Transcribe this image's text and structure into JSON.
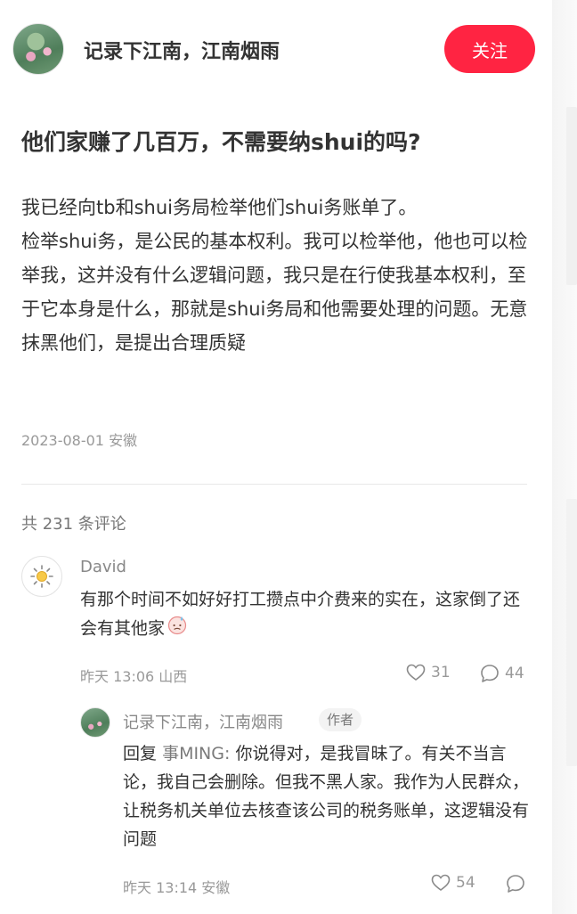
{
  "header": {
    "author_name": "记录下江南，江南烟雨",
    "follow_label": "关注"
  },
  "post": {
    "title": "他们家赚了几百万，不需要纳shui的吗?",
    "paragraph_1": "我已经向tb和shui务局检举他们shui务账单了。",
    "paragraph_2": "检举shui务，是公民的基本权利。我可以检举他，他也可以检举我，这并没有什么逻辑问题，我只是在行使我基本权利，至于它本身是什么，那就是shui务局和他需要处理的问题。无意抹黑他们，是提出合理质疑",
    "date": "2023-08-01",
    "location": "安徽"
  },
  "comments_header": {
    "count_text": "共 231 条评论"
  },
  "comments": [
    {
      "user": "David",
      "avatar_icon": "sun-icon",
      "text": "有那个时间不如好好打工攒点中介费来的实在，这家倒了还会有其他家",
      "emoji": "😓",
      "time": "昨天 13:06",
      "location": "山西",
      "likes": "31",
      "replies": "44"
    }
  ],
  "reply": {
    "user": "记录下江南，江南烟雨",
    "badge": "作者",
    "prefix": "回复",
    "mention": "事MING:",
    "text": "你说得对，是我冒昧了。有关不当言论，我自己会删除。但我不黑人家。我作为人民群众，让税务机关单位去核查该公司的税务账单，这逻辑没有问题",
    "time": "昨天 13:14",
    "location": "安徽",
    "likes": "54"
  },
  "colors": {
    "accent": "#ff2442",
    "text_primary": "#333333",
    "text_secondary": "#999999"
  }
}
